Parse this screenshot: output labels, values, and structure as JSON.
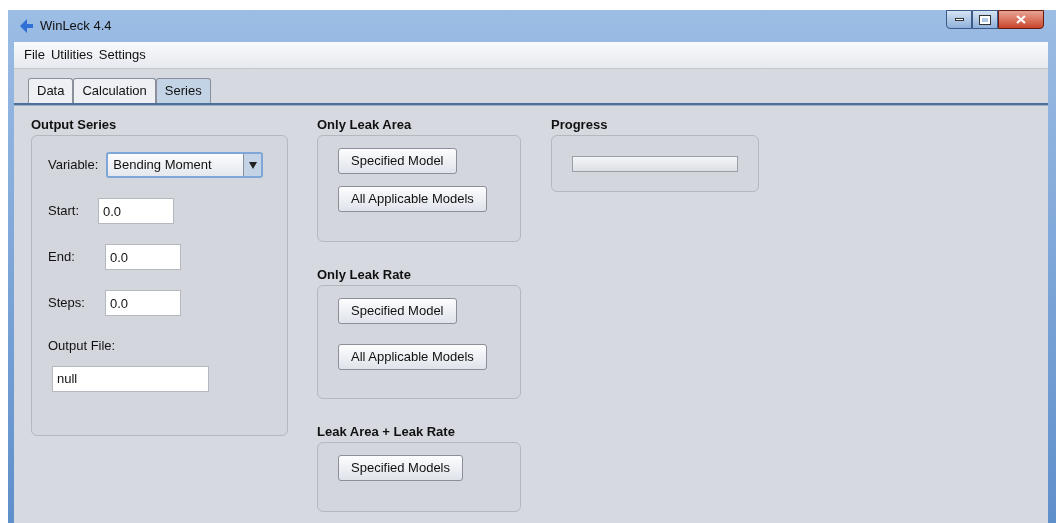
{
  "window": {
    "title": "WinLeck 4.4"
  },
  "menu": [
    "File",
    "Utilities",
    "Settings"
  ],
  "tabs": [
    {
      "label": "Data",
      "selected": false
    },
    {
      "label": "Calculation",
      "selected": false
    },
    {
      "label": "Series",
      "selected": true
    }
  ],
  "output_series": {
    "title": "Output Series",
    "variable": {
      "label": "Variable:",
      "value": "Bending Moment"
    },
    "fields": [
      {
        "label": "Start:",
        "value": "0.0"
      },
      {
        "label": "End:",
        "value": "0.0"
      },
      {
        "label": "Steps:",
        "value": "0.0"
      }
    ],
    "output_file": {
      "label": "Output File:",
      "value": "null"
    }
  },
  "groups": [
    {
      "title": "Only Leak Area",
      "buttons": [
        "Specified Model",
        "All Applicable Models"
      ]
    },
    {
      "title": "Only Leak Rate",
      "buttons": [
        "Specified Model",
        "All Applicable Models"
      ]
    },
    {
      "title": "Leak Area + Leak Rate",
      "buttons": [
        "Specified Models"
      ]
    }
  ],
  "progress": {
    "title": "Progress",
    "level": 0
  }
}
